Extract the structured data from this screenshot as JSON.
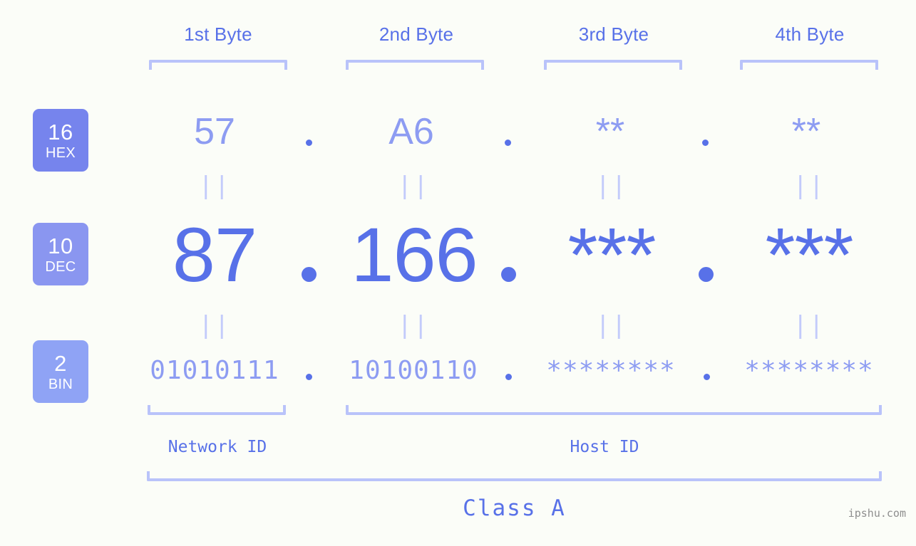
{
  "page": {
    "background_color": "#fbfdf8",
    "accent_color": "#5871e8",
    "accent_light_color": "#8d9cf2",
    "bracket_color": "#b9c3fa",
    "watermark": "ipshu.com"
  },
  "byte_headers": [
    {
      "label": "1st Byte"
    },
    {
      "label": "2nd Byte"
    },
    {
      "label": "3rd Byte"
    },
    {
      "label": "4th Byte"
    }
  ],
  "rows": [
    {
      "badge_number": "16",
      "badge_abbr": "HEX",
      "badge_color": "#7684ed",
      "values": [
        "57",
        "A6",
        "**",
        "**"
      ],
      "separator": "."
    },
    {
      "badge_number": "10",
      "badge_abbr": "DEC",
      "badge_color": "#8a96f0",
      "values": [
        "87",
        "166",
        "***",
        "***"
      ],
      "separator": "."
    },
    {
      "badge_number": "2",
      "badge_abbr": "BIN",
      "badge_color": "#8fa3f5",
      "values": [
        "01010111",
        "10100110",
        "********",
        "********"
      ],
      "separator": "."
    }
  ],
  "equality_marks": {
    "symbol": "||",
    "count_per_gap": 4
  },
  "footer": {
    "network_id_label": "Network ID",
    "host_id_label": "Host ID",
    "class_label": "Class A"
  }
}
